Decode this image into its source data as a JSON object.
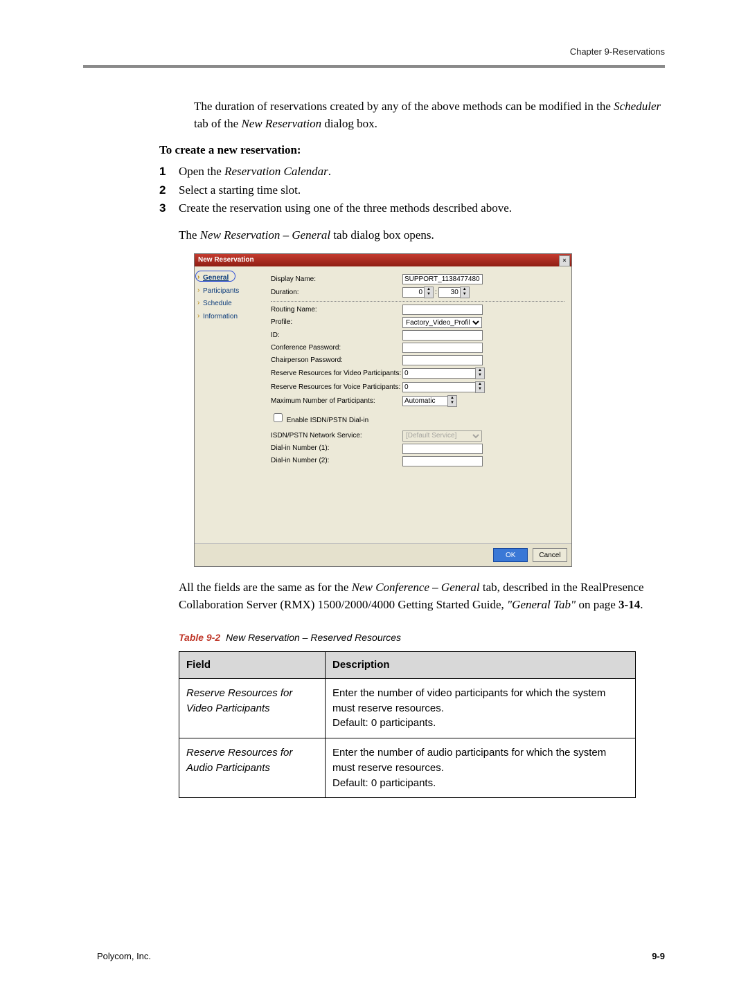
{
  "header": {
    "chapter": "Chapter 9-Reservations"
  },
  "intro": {
    "p1a": "The duration of reservations created by any of the above methods can be modified in the ",
    "p1b": "Scheduler",
    "p1c": " tab of the ",
    "p1d": "New Reservation",
    "p1e": " dialog box."
  },
  "procTitle": "To create a new reservation:",
  "steps": [
    {
      "n": "1",
      "a": "Open the ",
      "i": "Reservation Calendar",
      "b": "."
    },
    {
      "n": "2",
      "a": "Select a starting time slot.",
      "i": "",
      "b": ""
    },
    {
      "n": "3",
      "a": "Create the reservation using one of the three methods described above.",
      "i": "",
      "b": ""
    }
  ],
  "openLine": {
    "a": "The ",
    "i": "New Reservation – General",
    "b": " tab dialog box opens."
  },
  "dialog": {
    "title": "New Reservation",
    "nav": [
      "General",
      "Participants",
      "Schedule",
      "Information"
    ],
    "labels": {
      "displayName": "Display Name:",
      "duration": "Duration:",
      "routingName": "Routing Name:",
      "profile": "Profile:",
      "id": "ID:",
      "confPwd": "Conference Password:",
      "chairPwd": "Chairperson Password:",
      "resVideo": "Reserve Resources for Video Participants:",
      "resVoice": "Reserve Resources for Voice Participants:",
      "maxPart": "Maximum Number of Participants:",
      "enableISDN": "Enable ISDN/PSTN Dial-in",
      "isdnSvc": "ISDN/PSTN Network Service:",
      "dial1": "Dial-in Number (1):",
      "dial2": "Dial-in Number (2):"
    },
    "values": {
      "displayName": "SUPPORT_1138477480",
      "durH": "0",
      "durM": "30",
      "profile": "Factory_Video_Profile",
      "resVideo": "0",
      "resVoice": "0",
      "maxPart": "Automatic",
      "isdnSvc": "[Default Service]"
    },
    "buttons": {
      "ok": "OK",
      "cancel": "Cancel"
    }
  },
  "after": {
    "a": "All the fields are the same as for the ",
    "i1": "New Conference – General",
    "b": " tab, described in the RealPresence Collaboration Server (RMX) 1500/2000/4000 Getting Started Guide, ",
    "i2": "\"General Tab\"",
    "c": " on page ",
    "ref": "3-14",
    "d": "."
  },
  "tableCaption": {
    "label": "Table 9-2",
    "title": "New Reservation – Reserved Resources"
  },
  "tableHead": {
    "field": "Field",
    "desc": "Description"
  },
  "tableRows": [
    {
      "field": "Reserve Resources for Video Participants",
      "desc": "Enter the number of video participants for which the system must reserve resources.\nDefault: 0 participants."
    },
    {
      "field": "Reserve Resources for Audio Participants",
      "desc": "Enter the number of audio participants for which the system must reserve resources.\nDefault: 0 participants."
    }
  ],
  "footer": {
    "company": "Polycom, Inc.",
    "page": "9-9"
  }
}
